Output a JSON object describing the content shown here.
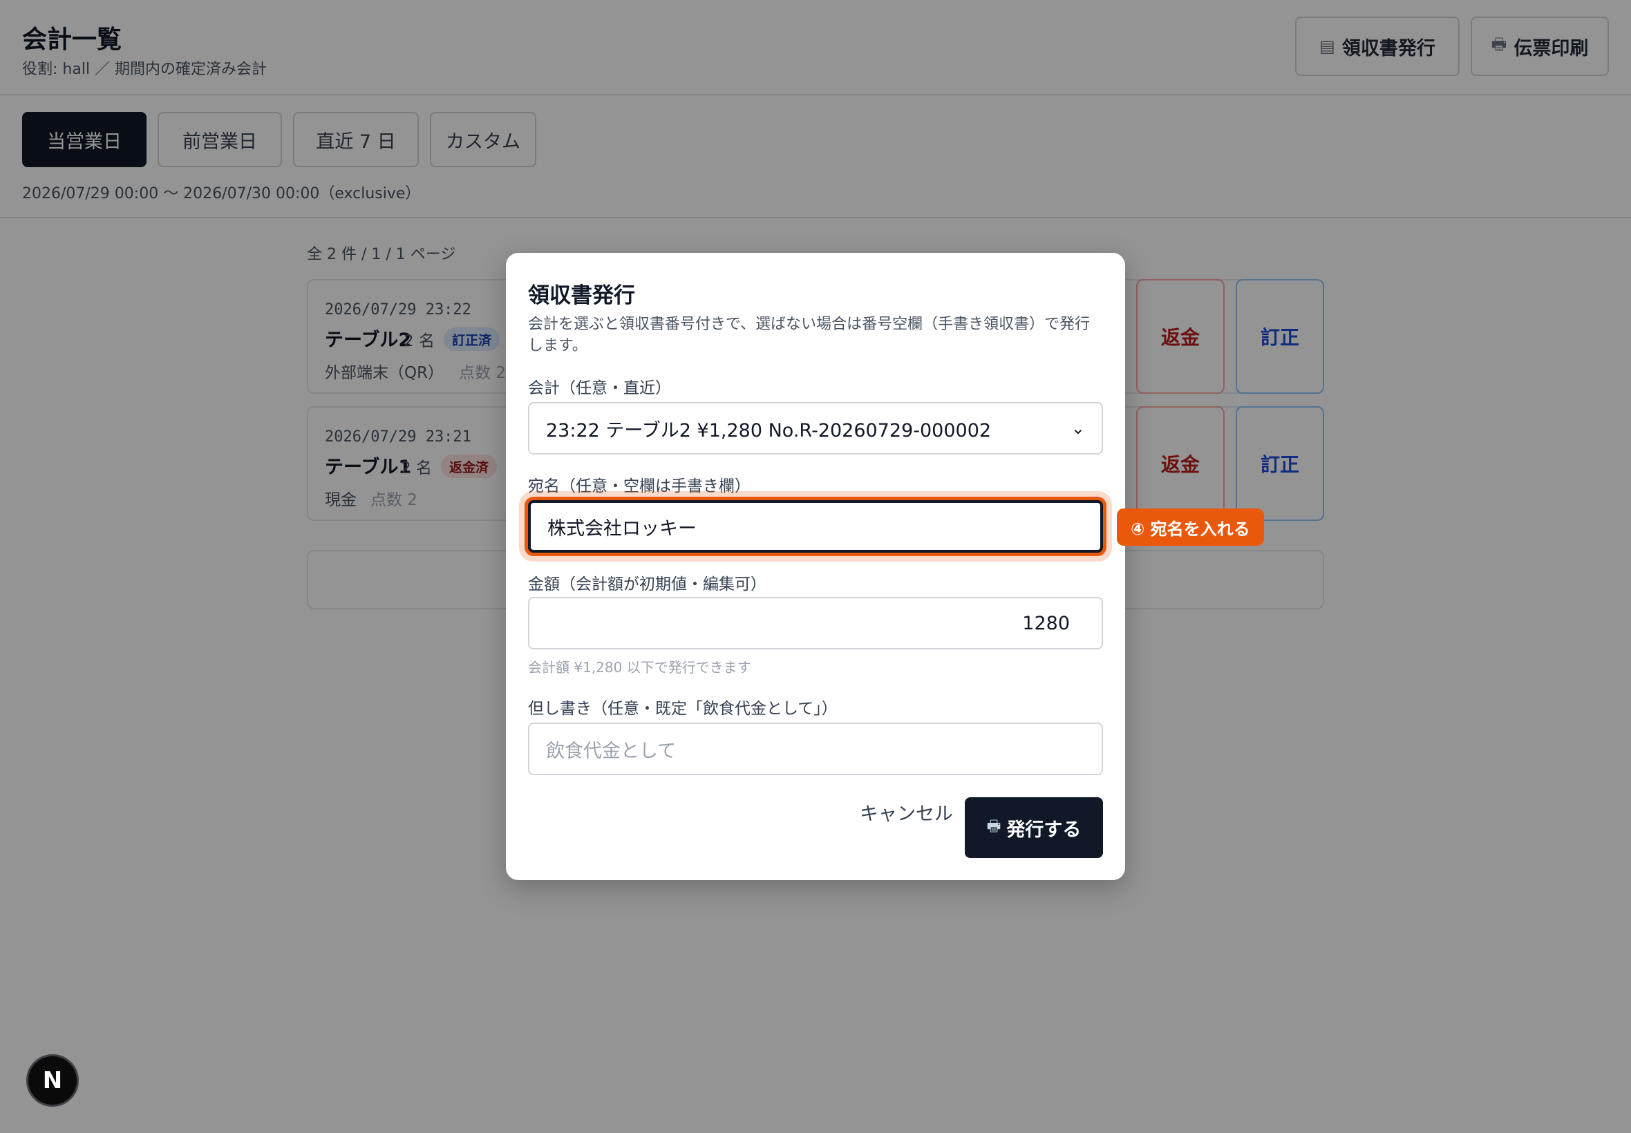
{
  "header": {
    "title": "会計一覧",
    "subtitle": "役割: hall ／ 期間内の確定済み会計",
    "receipt_icon": "▤",
    "receipt_button": "領収書発行",
    "print_icon": "🖶",
    "print_button": "伝票印刷"
  },
  "period": {
    "tabs": [
      "当営業日",
      "前営業日",
      "直近 7 日",
      "カスタム"
    ],
    "active": "当営業日",
    "range": "2026/07/29 00:00 〜 2026/07/30 00:00（exclusive）"
  },
  "list": {
    "count": "全 2 件 / 1 / 1 ページ",
    "rows": [
      {
        "time": "2026/07/29 23:22",
        "table": "テーブル2",
        "guests": "2 名",
        "badge": "訂正済",
        "payment": "外部端末（QR）",
        "items": "点数 2",
        "refund": "返金",
        "correct": "訂正"
      },
      {
        "time": "2026/07/29 23:21",
        "table": "テーブル1",
        "guests": "2 名",
        "badge": "返金済",
        "payment": "現金",
        "items": "点数 2",
        "refund": "返金",
        "correct": "訂正"
      }
    ]
  },
  "modal": {
    "title": "領収書発行",
    "description": "会計を選ぶと領収書番号付きで、選ばない場合は番号空欄（手書き領収書）で発行します。",
    "account_label": "会計（任意・直近）",
    "account_value": "23:22 テーブル2 ¥1,280 No.R-20260729-000002",
    "recipient_label": "宛名（任意・空欄は手書き欄）",
    "recipient_value": "株式会社ロッキー",
    "amount_label": "金額（会計額が初期値・編集可）",
    "amount_value": "1280",
    "amount_hint": "会計額 ¥1,280 以下で発行できます",
    "note_label": "但し書き（任意・既定「飲食代金として」）",
    "note_placeholder": "飲食代金として",
    "cancel": "キャンセル",
    "submit_icon": "🖶",
    "submit": "発行する"
  },
  "callout": "④ 宛名を入れる",
  "dev_badge": "N",
  "colors": {
    "primary": "#111827",
    "accent": "#ea580c",
    "refund": "#b91c1c",
    "correct": "#1d4ed8"
  }
}
